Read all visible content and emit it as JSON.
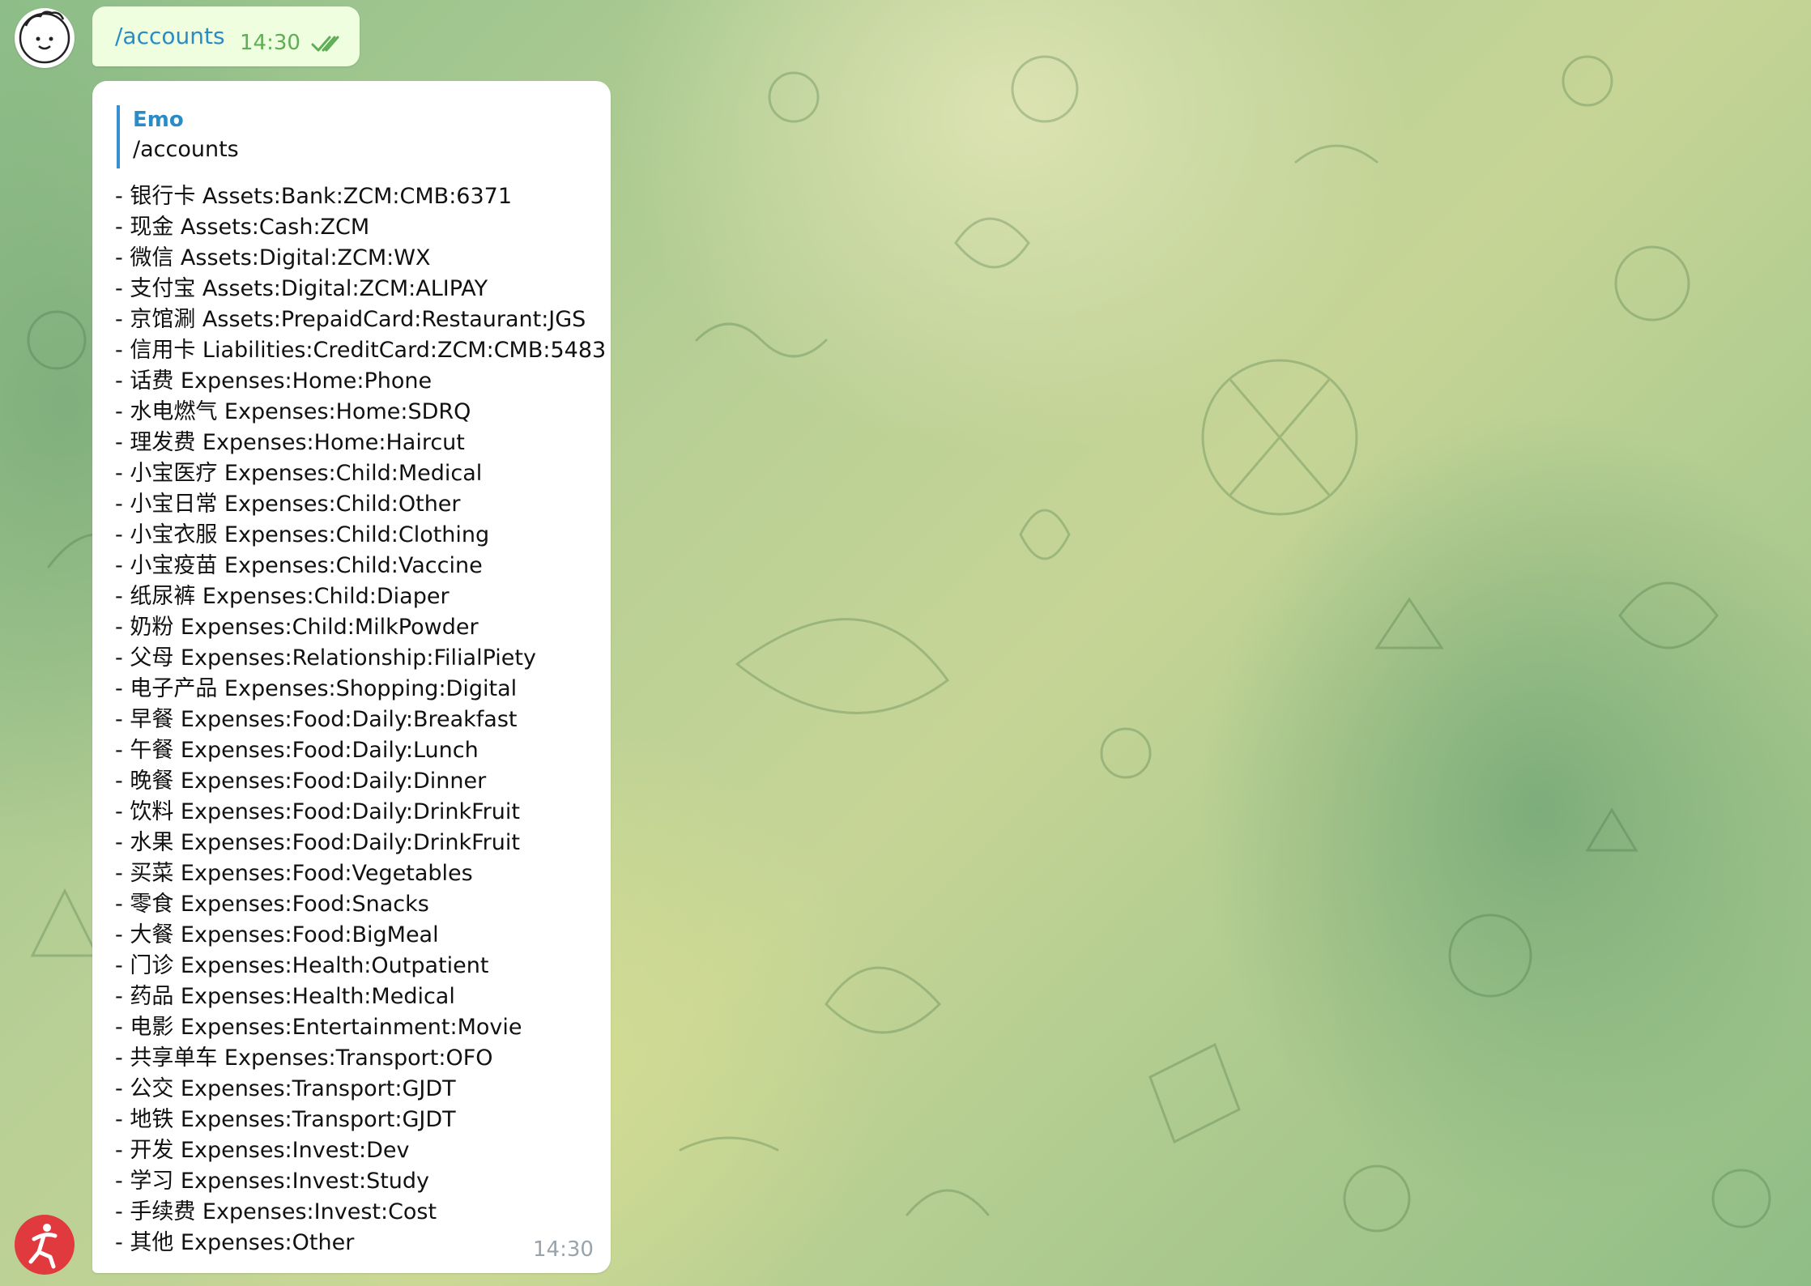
{
  "colors": {
    "accent": "#2a8bc6",
    "outgoing_bubble": "#eefedf",
    "incoming_bubble": "#ffffff",
    "check_marks": "#5fae55",
    "timestamp_in": "#9aa3aa",
    "bot_avatar": "#e0393e"
  },
  "outgoing_message": {
    "text": "/accounts",
    "time": "14:30",
    "status_icon": "double-check-icon"
  },
  "incoming_message": {
    "reply": {
      "author": "Emo",
      "text": "/accounts"
    },
    "time": "14:30",
    "accounts": [
      "- 银行卡 Assets:Bank:ZCM:CMB:6371",
      "- 现金 Assets:Cash:ZCM",
      "- 微信 Assets:Digital:ZCM:WX",
      "- 支付宝 Assets:Digital:ZCM:ALIPAY",
      "- 京馆涮 Assets:PrepaidCard:Restaurant:JGS",
      "- 信用卡 Liabilities:CreditCard:ZCM:CMB:5483",
      "- 话费 Expenses:Home:Phone",
      "- 水电燃气 Expenses:Home:SDRQ",
      "- 理发费 Expenses:Home:Haircut",
      "- 小宝医疗 Expenses:Child:Medical",
      "- 小宝日常 Expenses:Child:Other",
      "- 小宝衣服 Expenses:Child:Clothing",
      "- 小宝疫苗 Expenses:Child:Vaccine",
      "- 纸尿裤 Expenses:Child:Diaper",
      "- 奶粉 Expenses:Child:MilkPowder",
      "- 父母 Expenses:Relationship:FilialPiety",
      "- 电子产品 Expenses:Shopping:Digital",
      "- 早餐 Expenses:Food:Daily:Breakfast",
      "- 午餐 Expenses:Food:Daily:Lunch",
      "- 晚餐 Expenses:Food:Daily:Dinner",
      "- 饮料 Expenses:Food:Daily:DrinkFruit",
      "- 水果 Expenses:Food:Daily:DrinkFruit",
      "- 买菜 Expenses:Food:Vegetables",
      "- 零食 Expenses:Food:Snacks",
      "- 大餐 Expenses:Food:BigMeal",
      "- 门诊 Expenses:Health:Outpatient",
      "- 药品 Expenses:Health:Medical",
      "- 电影 Expenses:Entertainment:Movie",
      "- 共享单车 Expenses:Transport:OFO",
      "- 公交 Expenses:Transport:GJDT",
      "- 地铁 Expenses:Transport:GJDT",
      "- 开发 Expenses:Invest:Dev",
      "- 学习 Expenses:Invest:Study",
      "- 手续费 Expenses:Invest:Cost",
      "- 其他 Expenses:Other"
    ]
  }
}
